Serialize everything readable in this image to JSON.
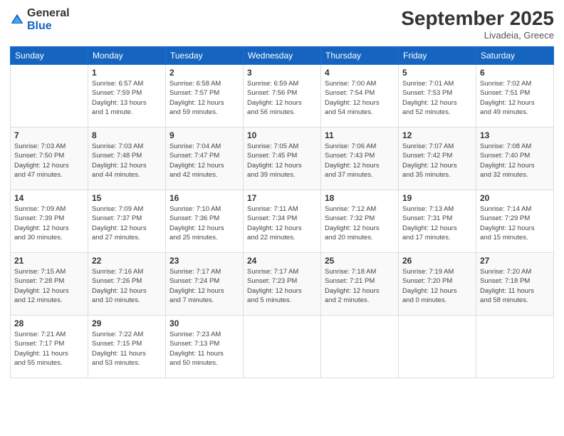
{
  "logo": {
    "general": "General",
    "blue": "Blue"
  },
  "header": {
    "month": "September 2025",
    "location": "Livadeia, Greece"
  },
  "days_of_week": [
    "Sunday",
    "Monday",
    "Tuesday",
    "Wednesday",
    "Thursday",
    "Friday",
    "Saturday"
  ],
  "weeks": [
    [
      {
        "day": "",
        "info": ""
      },
      {
        "day": "1",
        "info": "Sunrise: 6:57 AM\nSunset: 7:59 PM\nDaylight: 13 hours\nand 1 minute."
      },
      {
        "day": "2",
        "info": "Sunrise: 6:58 AM\nSunset: 7:57 PM\nDaylight: 12 hours\nand 59 minutes."
      },
      {
        "day": "3",
        "info": "Sunrise: 6:59 AM\nSunset: 7:56 PM\nDaylight: 12 hours\nand 56 minutes."
      },
      {
        "day": "4",
        "info": "Sunrise: 7:00 AM\nSunset: 7:54 PM\nDaylight: 12 hours\nand 54 minutes."
      },
      {
        "day": "5",
        "info": "Sunrise: 7:01 AM\nSunset: 7:53 PM\nDaylight: 12 hours\nand 52 minutes."
      },
      {
        "day": "6",
        "info": "Sunrise: 7:02 AM\nSunset: 7:51 PM\nDaylight: 12 hours\nand 49 minutes."
      }
    ],
    [
      {
        "day": "7",
        "info": "Sunrise: 7:03 AM\nSunset: 7:50 PM\nDaylight: 12 hours\nand 47 minutes."
      },
      {
        "day": "8",
        "info": "Sunrise: 7:03 AM\nSunset: 7:48 PM\nDaylight: 12 hours\nand 44 minutes."
      },
      {
        "day": "9",
        "info": "Sunrise: 7:04 AM\nSunset: 7:47 PM\nDaylight: 12 hours\nand 42 minutes."
      },
      {
        "day": "10",
        "info": "Sunrise: 7:05 AM\nSunset: 7:45 PM\nDaylight: 12 hours\nand 39 minutes."
      },
      {
        "day": "11",
        "info": "Sunrise: 7:06 AM\nSunset: 7:43 PM\nDaylight: 12 hours\nand 37 minutes."
      },
      {
        "day": "12",
        "info": "Sunrise: 7:07 AM\nSunset: 7:42 PM\nDaylight: 12 hours\nand 35 minutes."
      },
      {
        "day": "13",
        "info": "Sunrise: 7:08 AM\nSunset: 7:40 PM\nDaylight: 12 hours\nand 32 minutes."
      }
    ],
    [
      {
        "day": "14",
        "info": "Sunrise: 7:09 AM\nSunset: 7:39 PM\nDaylight: 12 hours\nand 30 minutes."
      },
      {
        "day": "15",
        "info": "Sunrise: 7:09 AM\nSunset: 7:37 PM\nDaylight: 12 hours\nand 27 minutes."
      },
      {
        "day": "16",
        "info": "Sunrise: 7:10 AM\nSunset: 7:36 PM\nDaylight: 12 hours\nand 25 minutes."
      },
      {
        "day": "17",
        "info": "Sunrise: 7:11 AM\nSunset: 7:34 PM\nDaylight: 12 hours\nand 22 minutes."
      },
      {
        "day": "18",
        "info": "Sunrise: 7:12 AM\nSunset: 7:32 PM\nDaylight: 12 hours\nand 20 minutes."
      },
      {
        "day": "19",
        "info": "Sunrise: 7:13 AM\nSunset: 7:31 PM\nDaylight: 12 hours\nand 17 minutes."
      },
      {
        "day": "20",
        "info": "Sunrise: 7:14 AM\nSunset: 7:29 PM\nDaylight: 12 hours\nand 15 minutes."
      }
    ],
    [
      {
        "day": "21",
        "info": "Sunrise: 7:15 AM\nSunset: 7:28 PM\nDaylight: 12 hours\nand 12 minutes."
      },
      {
        "day": "22",
        "info": "Sunrise: 7:16 AM\nSunset: 7:26 PM\nDaylight: 12 hours\nand 10 minutes."
      },
      {
        "day": "23",
        "info": "Sunrise: 7:17 AM\nSunset: 7:24 PM\nDaylight: 12 hours\nand 7 minutes."
      },
      {
        "day": "24",
        "info": "Sunrise: 7:17 AM\nSunset: 7:23 PM\nDaylight: 12 hours\nand 5 minutes."
      },
      {
        "day": "25",
        "info": "Sunrise: 7:18 AM\nSunset: 7:21 PM\nDaylight: 12 hours\nand 2 minutes."
      },
      {
        "day": "26",
        "info": "Sunrise: 7:19 AM\nSunset: 7:20 PM\nDaylight: 12 hours\nand 0 minutes."
      },
      {
        "day": "27",
        "info": "Sunrise: 7:20 AM\nSunset: 7:18 PM\nDaylight: 11 hours\nand 58 minutes."
      }
    ],
    [
      {
        "day": "28",
        "info": "Sunrise: 7:21 AM\nSunset: 7:17 PM\nDaylight: 11 hours\nand 55 minutes."
      },
      {
        "day": "29",
        "info": "Sunrise: 7:22 AM\nSunset: 7:15 PM\nDaylight: 11 hours\nand 53 minutes."
      },
      {
        "day": "30",
        "info": "Sunrise: 7:23 AM\nSunset: 7:13 PM\nDaylight: 11 hours\nand 50 minutes."
      },
      {
        "day": "",
        "info": ""
      },
      {
        "day": "",
        "info": ""
      },
      {
        "day": "",
        "info": ""
      },
      {
        "day": "",
        "info": ""
      }
    ]
  ]
}
